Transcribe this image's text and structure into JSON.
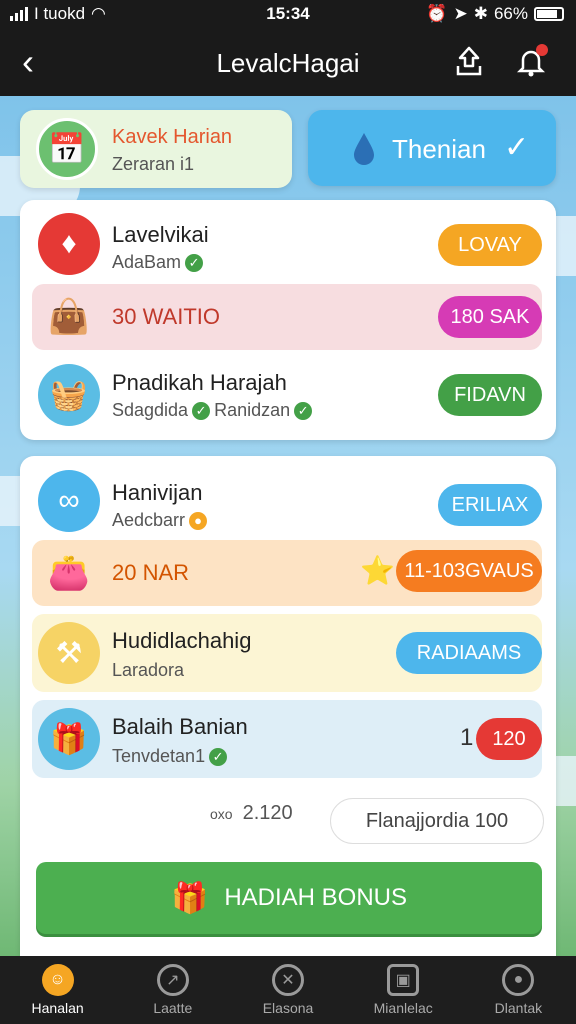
{
  "status": {
    "carrier": "I tuokd",
    "time": "15:34",
    "battery": "66%"
  },
  "header": {
    "title": "LevalcHagai"
  },
  "top_tabs": {
    "left": {
      "title": "Kavek Harian",
      "subtitle": "Zeraran i1"
    },
    "right": {
      "label": "Thenian"
    }
  },
  "panel1": [
    {
      "title": "Lavelvikai",
      "subtitle": "AdaBam",
      "button": "LOVAY",
      "button_color": "#f5a623"
    },
    {
      "promo": "30 WAITIO",
      "button": "180 SAK",
      "button_color": "#d63bb5"
    },
    {
      "title": "Pnadikah Harajah",
      "subtitle": "Sdagdida",
      "subtitle2": "Ranidzan",
      "button": "FIDAVN",
      "button_color": "#43a047"
    }
  ],
  "panel2": [
    {
      "title": "Hanivijan",
      "subtitle": "Aedcbarr",
      "button": "ERILIAX",
      "button_color": "#4db6ec"
    },
    {
      "promo": "20 NAR",
      "button": "11-103GVAUS",
      "button_color": "#f57c20"
    },
    {
      "title": "Hudidlachahig",
      "subtitle": "Laradora",
      "button": "RADIAAMS",
      "button_color": "#4db6ec"
    },
    {
      "title": "Balaih Banian",
      "subtitle": "Tenvdetan1",
      "count": "1",
      "button": "120",
      "button_color": "#e53935"
    }
  ],
  "amount": {
    "prefix": "oxo",
    "value": "2.120",
    "input_value": "Flanajjordia 100"
  },
  "bonus_button": {
    "label": "HADIAH BONUS"
  },
  "nav": [
    {
      "label": "Hanalan",
      "icon": "avatar-icon",
      "active": true
    },
    {
      "label": "Laatte",
      "icon": "compass-icon",
      "active": false
    },
    {
      "label": "Elasona",
      "icon": "tools-icon",
      "active": false
    },
    {
      "label": "Mianlelac",
      "icon": "box-icon",
      "active": false
    },
    {
      "label": "Dlantak",
      "icon": "user-icon",
      "active": false
    }
  ],
  "colors": {
    "primary_blue": "#4db6ec",
    "green": "#4caf50",
    "orange": "#f5a623",
    "magenta": "#d63bb5"
  }
}
